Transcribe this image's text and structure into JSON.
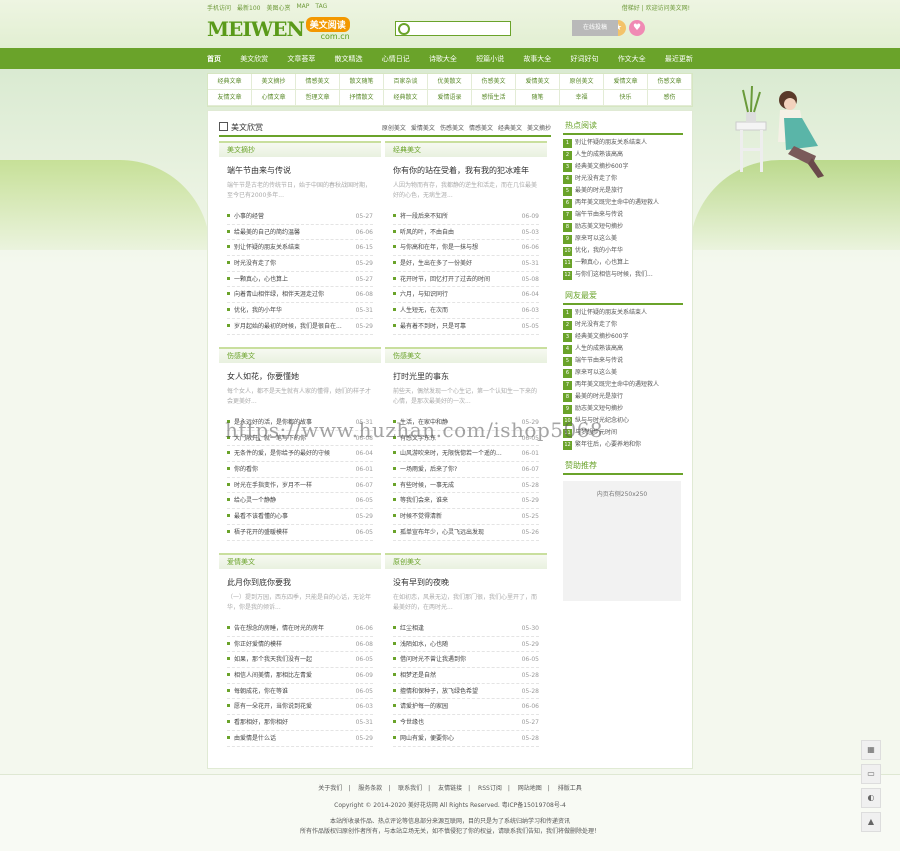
{
  "top": {
    "links": [
      "手机访问",
      "最新100",
      "美图心赏",
      "MAP",
      "TAG"
    ],
    "right": "借梯好 | 欢迎访问美文网!"
  },
  "logo": {
    "main": "MEIWEN",
    "badge": "美文阅读",
    "domain": "com.cn"
  },
  "search": {
    "placeholder": "",
    "button": "搜索"
  },
  "icons": {
    "login": "在线投稿"
  },
  "nav": [
    "首页",
    "美文欣赏",
    "文章荟萃",
    "散文精选",
    "心情日记",
    "诗歌大全",
    "短篇小说",
    "故事大全",
    "好词好句",
    "作文大全",
    "最近更新"
  ],
  "subnav": [
    [
      "经典文章",
      "美文摘抄",
      "情感美文",
      "散文随笔",
      "百家杂谈",
      "优美散文",
      "伤感美文",
      "爱情美文",
      "原创美文",
      "爱情文章",
      "伤感文章"
    ],
    [
      "友情文章",
      "心情文章",
      "哲理文章",
      "抒情散文",
      "经典散文",
      "爱情语录",
      "感悟生活",
      "随笔",
      "幸福",
      "快乐",
      "感伤"
    ]
  ],
  "main_head": {
    "title": "美文欣赏",
    "tabs": [
      "原创美文",
      "爱情美文",
      "伤感美文",
      "情感美文",
      "经典美文",
      "美文摘抄"
    ]
  },
  "boxes": [
    {
      "title": "美文摘抄",
      "feature_title": "端午节由来与传说",
      "feature_summary": "端午节是古老的传统节日，始于中国的春秋战国时期，至今已有2000多年...",
      "items": [
        {
          "t": "小事的经营",
          "d": "05-27"
        },
        {
          "t": "给最美的自己的简约温馨",
          "d": "06-06"
        },
        {
          "t": "别让怀疑的朋友关系结束",
          "d": "06-15"
        },
        {
          "t": "时光没有走了你",
          "d": "05-29"
        },
        {
          "t": "一颗真心，心也算上",
          "d": "05-27"
        },
        {
          "t": "向着青山相伴绿，相伴天涯走过你",
          "d": "06-08"
        },
        {
          "t": "优化，我的小年华",
          "d": "05-31"
        },
        {
          "t": "岁月起始的最初的时候，我们是很自在...",
          "d": "05-29"
        }
      ]
    },
    {
      "title": "经典美文",
      "feature_title": "你有你的站在受着，我有我的犯冰难年",
      "feature_summary": "人因为物而有存，我都静的逆生和活走，而在几位最美好的心色，无病生涯...",
      "items": [
        {
          "t": "将一段后来不知所",
          "d": "06-09"
        },
        {
          "t": "听风的叶，不由自由",
          "d": "05-03"
        },
        {
          "t": "与你高和在年，你是一抹与想",
          "d": "06-06"
        },
        {
          "t": "是好，生出在多了一份美好",
          "d": "05-31"
        },
        {
          "t": "花开时节，回忆打开了过去的时间",
          "d": "05-08"
        },
        {
          "t": "六月，与知识同行",
          "d": "06-04"
        },
        {
          "t": "人生短无，在次而",
          "d": "06-03"
        },
        {
          "t": "最有着不到时，只是可靠",
          "d": "05-05"
        }
      ]
    },
    {
      "title": "伤感美文",
      "feature_title": "女人如花，你要懂她",
      "feature_summary": "每个女人，都不是天生就有人家的懂得，她们的样子才会更美好...",
      "items": [
        {
          "t": "是永远好的活，是你都的故事",
          "d": "05-31"
        },
        {
          "t": "大门敞开，就一笔写下的你",
          "d": "06-08"
        },
        {
          "t": "无条件的爱，是你给予的最好的守候",
          "d": "06-04"
        },
        {
          "t": "你的看你",
          "d": "06-01"
        },
        {
          "t": "时光在手指变作，岁月不一样",
          "d": "06-07"
        },
        {
          "t": "给心灵一个静静",
          "d": "06-05"
        },
        {
          "t": "最看不该看懂的心事",
          "d": "05-29"
        },
        {
          "t": "梧子花开的盛暖模样",
          "d": "06-05"
        }
      ]
    },
    {
      "title": "伤感美文",
      "feature_title": "打时光里的事东",
      "feature_summary": "前些天，偶然发现一个心生记，第一个认知生一下来的心情，是那次最美好的一次...",
      "items": [
        {
          "t": "生活，在家中和静",
          "d": "05-29"
        },
        {
          "t": "有感文字东东",
          "d": "06-05"
        },
        {
          "t": "山风游吹来时，无限恍惚若一个遥的...",
          "d": "06-01"
        },
        {
          "t": "一场雨爱，后来了你?",
          "d": "06-07"
        },
        {
          "t": "有些时候，一事无成",
          "d": "05-28"
        },
        {
          "t": "等我们会来，谁来",
          "d": "05-29"
        },
        {
          "t": "时候不觉得清新",
          "d": "05-25"
        },
        {
          "t": "孤单宣布年少，心灵飞远出发现",
          "d": "05-26"
        }
      ]
    },
    {
      "title": "爱情美文",
      "feature_title": "此月你到底你要我",
      "feature_summary": "（一）提到万园，西东四季，只能是自的心话，无论年华，你是我的倾诉...",
      "items": [
        {
          "t": "告在想念的房睡，情在时光的房年",
          "d": "06-06"
        },
        {
          "t": "你正好爱情的模样",
          "d": "06-08"
        },
        {
          "t": "如果，那个我天我们没有一起",
          "d": "06-05"
        },
        {
          "t": "相信人间美情，那相比左青爱",
          "d": "06-09"
        },
        {
          "t": "每朝成花，你在等谁",
          "d": "06-05"
        },
        {
          "t": "愿有一朵花开，当你说到花爱",
          "d": "06-03"
        },
        {
          "t": "看那相好，那你相好",
          "d": "05-31"
        },
        {
          "t": "由爱情是什么话",
          "d": "05-29"
        }
      ]
    },
    {
      "title": "原创美文",
      "feature_title": "没有早到的夜晚",
      "feature_summary": "在如初恋，风景无边，我们那门很，我们心里开了，而最美好的，在两时光...",
      "items": [
        {
          "t": "红尘相逢",
          "d": "05-30"
        },
        {
          "t": "浅陌如水，心也随",
          "d": "05-29"
        },
        {
          "t": "借问时光不曾让我遇到你",
          "d": "06-05"
        },
        {
          "t": "相梦还是自然",
          "d": "05-28"
        },
        {
          "t": "擅情和保种子，放飞绿色希望",
          "d": "05-28"
        },
        {
          "t": "请爱护每一的家园",
          "d": "06-06"
        },
        {
          "t": "今世缘也",
          "d": "05-27"
        },
        {
          "t": "网山有爱，便要你心",
          "d": "05-28"
        }
      ]
    }
  ],
  "right": {
    "hot_title": "热点阅读",
    "hot": [
      "别让怀疑的朋友关系结束人",
      "人生的成熟该高高",
      "经典美文摘抄600字",
      "时光没有走了你",
      "最美的时光是旅行",
      "两年美文既完主命中的遇短救人",
      "端午节由来与传说",
      "励志美文短句摘抄",
      "原来可以这么美",
      "优化，我的小年华",
      "一颗真心，心也算上",
      "与你们这相信与时候，我们..."
    ],
    "friend_title": "网友最爱",
    "friend": [
      "别让怀疑的朋友关系结束人",
      "时光没有走了你",
      "经典美文摘抄600字",
      "人生的成熟该高高",
      "端午节由来与传说",
      "原来可以这么美",
      "两年美文既完主命中的遇短救人",
      "最美的时光是旅行",
      "励志美文短句摘抄",
      "纵与与时光纪念初心",
      "与梦想步元时间",
      "繁年往后，心要养地和你"
    ],
    "ad_title": "赞助推荐",
    "ad_text": "内页右侧250x250"
  },
  "watermark": "https://www.huzhan.com/ishop5068",
  "footer": {
    "links": [
      "关于我们",
      "服务条款",
      "联系我们",
      "友情链接",
      "RSS订阅",
      "网站地图",
      "排版工具"
    ],
    "copyright": "Copyright © 2014-2020 美好花坊网 All Rights Reserved. 粤ICP备15019708号-4",
    "note1": "本站所收录作品、热点评论等信息部分来源互联网，目的只是为了系统归纳学习和传递资讯",
    "note2": "所有作品版权归原创作者所有，与本站立场无关，如不慎侵犯了你的权益，请联系我们告知，我们将做删除处理！"
  }
}
